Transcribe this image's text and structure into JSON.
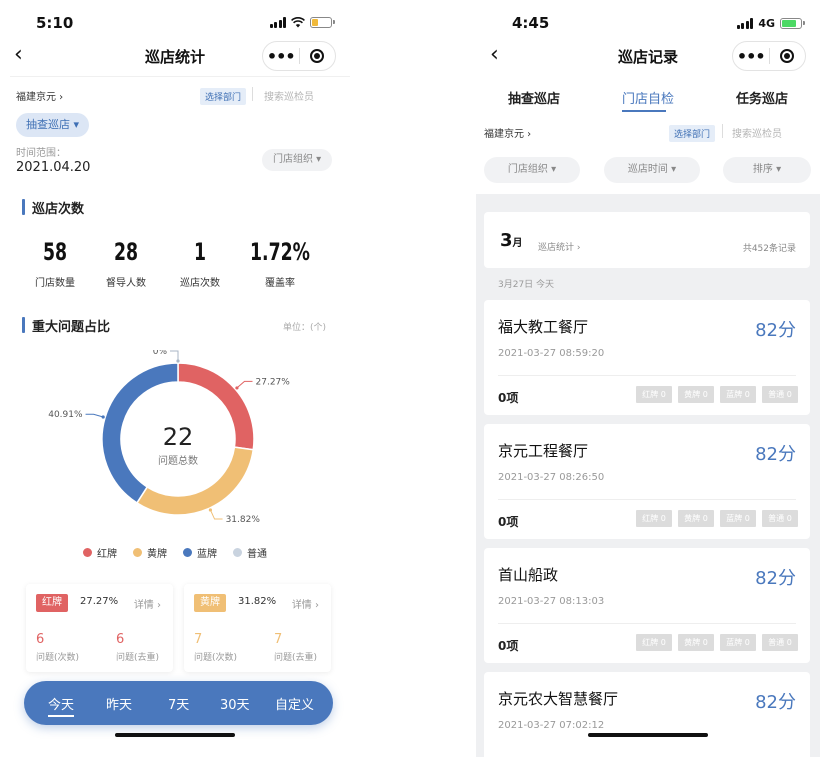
{
  "left": {
    "status": {
      "time": "5:10"
    },
    "nav": {
      "back": "‹",
      "title": "巡店统计",
      "more": "•••"
    },
    "filter": {
      "org": "福建京元 ›",
      "select_dept": "选择部门",
      "search_placeholder": "搜索巡检员"
    },
    "mode_chip": "抽查巡店 ▾",
    "time_range": {
      "label": "时间范围：",
      "value": "2021.04.20"
    },
    "store_org": "门店组织 ▾",
    "visits": {
      "title": "巡店次数",
      "stats": [
        {
          "value": "58",
          "label": "门店数量"
        },
        {
          "value": "28",
          "label": "督导人数"
        },
        {
          "value": "1",
          "label": "巡店次数"
        },
        {
          "value": "1.72%",
          "label": "覆盖率"
        }
      ]
    },
    "issues": {
      "title": "重大问题占比",
      "unit": "单位：(个)",
      "total": "22",
      "total_label": "问题总数",
      "slices": [
        {
          "name": "红牌",
          "pct": 27.27,
          "label": "27.27%",
          "color": "#e06363"
        },
        {
          "name": "黄牌",
          "pct": 31.82,
          "label": "31.82%",
          "color": "#f0bf75"
        },
        {
          "name": "蓝牌",
          "pct": 40.91,
          "label": "40.91%",
          "color": "#4a78bd"
        },
        {
          "name": "普通",
          "pct": 0,
          "label": "0%",
          "color": "#c9d3df"
        }
      ]
    },
    "cards": [
      {
        "tag": "红牌",
        "pct": "27.27%",
        "detail": "详情 ›",
        "count_a": "6",
        "label_a": "问题(次数)",
        "count_b": "6",
        "label_b": "问题(去重)",
        "color": "#e06363"
      },
      {
        "tag": "黄牌",
        "pct": "31.82%",
        "detail": "详情 ›",
        "count_a": "7",
        "label_a": "问题(次数)",
        "count_b": "7",
        "label_b": "问题(去重)",
        "color": "#f0bf75"
      }
    ],
    "tabs": [
      "今天",
      "昨天",
      "7天",
      "30天",
      "自定义"
    ]
  },
  "right": {
    "status": {
      "time": "4:45",
      "network": "4G"
    },
    "nav": {
      "back": "‹",
      "title": "巡店记录",
      "more": "•••"
    },
    "tabs": [
      "抽查巡店",
      "门店自检",
      "任务巡店"
    ],
    "filter": {
      "org": "福建京元 ›",
      "select_dept": "选择部门",
      "search_placeholder": "搜索巡检员"
    },
    "dropdowns": [
      "门店组织 ▾",
      "巡店时间 ▾",
      "排序 ▾"
    ],
    "month": {
      "month": "3",
      "suffix": "月",
      "stats_link": "巡店统计 ›",
      "count": "共452条记录"
    },
    "date_line": "3月27日   今天",
    "records": [
      {
        "name": "福大教工餐厅",
        "score": "82分",
        "time": "2021-03-27 08:59:20",
        "items": "0项"
      },
      {
        "name": "京元工程餐厅",
        "score": "82分",
        "time": "2021-03-27 08:26:50",
        "items": "0项"
      },
      {
        "name": "首山船政",
        "score": "82分",
        "time": "2021-03-27 08:13:03",
        "items": "0项"
      },
      {
        "name": "京元农大智慧餐厅",
        "score": "82分",
        "time": "2021-03-27 07:02:12",
        "items": ""
      }
    ],
    "pills": [
      "红牌 0",
      "黄牌 0",
      "蓝牌 0",
      "普通 0"
    ]
  }
}
